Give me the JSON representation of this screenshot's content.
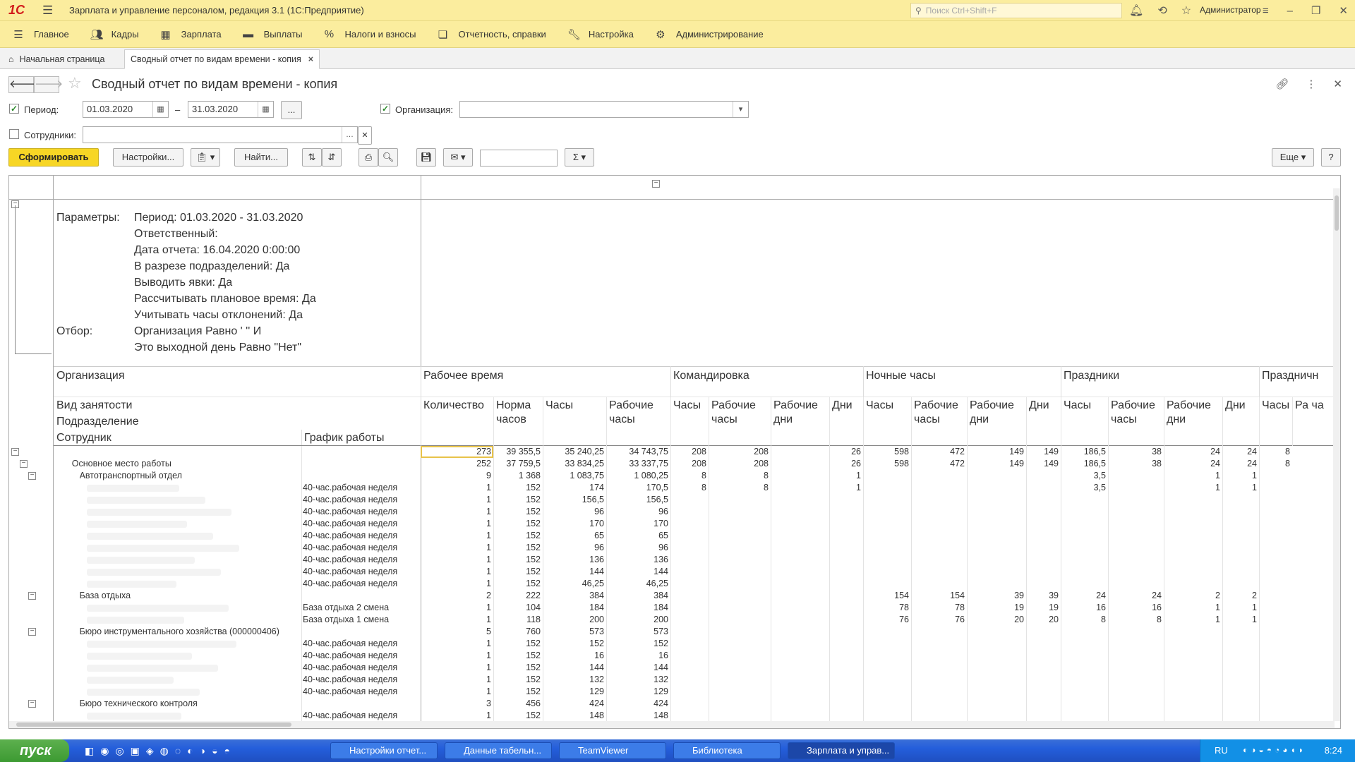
{
  "window": {
    "title": "Зарплата и управление персоналом, редакция 3.1  (1С:Предприятие)",
    "logo": "1С",
    "search_placeholder": "Поиск Ctrl+Shift+F",
    "user": "Администратор"
  },
  "menu": [
    "Главное",
    "Кадры",
    "Зарплата",
    "Выплаты",
    "Налоги и взносы",
    "Отчетность, справки",
    "Настройка",
    "Администрирование"
  ],
  "tabs": {
    "home": "Начальная страница",
    "active": "Сводный отчет по видам времени - копия",
    "close": "×"
  },
  "form": {
    "title": "Сводный отчет по видам времени - копия"
  },
  "filters": {
    "period_label": "Период:",
    "date_from": "01.03.2020",
    "dash": "–",
    "date_to": "31.03.2020",
    "ellipsis": "...",
    "org_label": "Организация:",
    "emp_label": "Сотрудники:"
  },
  "toolbar": {
    "generate": "Сформировать",
    "settings": "Настройки...",
    "find": "Найти...",
    "more": "Еще",
    "help": "?"
  },
  "params": {
    "label_params": "Параметры:",
    "label_filter": "Отбор:",
    "lines": [
      "Период: 01.03.2020 - 31.03.2020",
      "Ответственный:",
      "Дата отчета: 16.04.2020 0:00:00",
      "В разрезе подразделений: Да",
      "Выводить явки: Да",
      "Рассчитывать плановое время: Да",
      "Учитывать часы отклонений: Да"
    ],
    "filter_lines": [
      "Организация Равно '                   '' И",
      "Это выходной день Равно \"Нет\""
    ]
  },
  "headers": {
    "left": [
      "Организация",
      "Вид занятости",
      "Подразделение",
      "Сотрудник",
      "График работы"
    ],
    "groups": [
      "Рабочее время",
      "Командировка",
      "Ночные часы",
      "Праздники",
      "Праздничн"
    ],
    "sub": [
      "Количество",
      "Норма часов",
      "Часы",
      "Рабочие часы",
      "Часы",
      "Рабочие часы",
      "Рабочие дни",
      "Дни",
      "Часы",
      "Рабочие часы",
      "Рабочие дни",
      "Дни",
      "Часы",
      "Рабочие часы",
      "Рабочие дни",
      "Дни",
      "Часы",
      "Ра ча"
    ]
  },
  "rows": [
    {
      "name": "",
      "sched": "",
      "v": [
        "273",
        "39 355,5",
        "35 240,25",
        "34 743,75",
        "208",
        "208",
        "",
        "26",
        "598",
        "472",
        "149",
        "149",
        "186,5",
        "38",
        "24",
        "24",
        "8"
      ],
      "level": 0
    },
    {
      "name": "Основное место работы",
      "sched": "",
      "v": [
        "252",
        "37 759,5",
        "33 834,25",
        "33 337,75",
        "208",
        "208",
        "",
        "26",
        "598",
        "472",
        "149",
        "149",
        "186,5",
        "38",
        "24",
        "24",
        "8"
      ],
      "level": 1
    },
    {
      "name": "Автотранспортный отдел",
      "sched": "",
      "v": [
        "9",
        "1 368",
        "1 083,75",
        "1 080,25",
        "8",
        "8",
        "",
        "1",
        "",
        "",
        "",
        "",
        "3,5",
        "",
        "1",
        "1",
        ""
      ],
      "level": 2
    },
    {
      "name": "",
      "sched": "40-час.рабочая неделя",
      "v": [
        "1",
        "152",
        "174",
        "170,5",
        "8",
        "8",
        "",
        "1",
        "",
        "",
        "",
        "",
        "3,5",
        "",
        "1",
        "1",
        ""
      ],
      "level": 3
    },
    {
      "name": "",
      "sched": "40-час.рабочая неделя",
      "v": [
        "1",
        "152",
        "156,5",
        "156,5",
        "",
        "",
        "",
        "",
        "",
        "",
        "",
        "",
        "",
        "",
        "",
        "",
        ""
      ],
      "level": 3
    },
    {
      "name": "",
      "sched": "40-час.рабочая неделя",
      "v": [
        "1",
        "152",
        "96",
        "96",
        "",
        "",
        "",
        "",
        "",
        "",
        "",
        "",
        "",
        "",
        "",
        "",
        ""
      ],
      "level": 3
    },
    {
      "name": "",
      "sched": "40-час.рабочая неделя",
      "v": [
        "1",
        "152",
        "170",
        "170",
        "",
        "",
        "",
        "",
        "",
        "",
        "",
        "",
        "",
        "",
        "",
        "",
        ""
      ],
      "level": 3
    },
    {
      "name": "",
      "sched": "40-час.рабочая неделя",
      "v": [
        "1",
        "152",
        "65",
        "65",
        "",
        "",
        "",
        "",
        "",
        "",
        "",
        "",
        "",
        "",
        "",
        "",
        ""
      ],
      "level": 3
    },
    {
      "name": "",
      "sched": "40-час.рабочая неделя",
      "v": [
        "1",
        "152",
        "96",
        "96",
        "",
        "",
        "",
        "",
        "",
        "",
        "",
        "",
        "",
        "",
        "",
        "",
        ""
      ],
      "level": 3
    },
    {
      "name": "",
      "sched": "40-час.рабочая неделя",
      "v": [
        "1",
        "152",
        "136",
        "136",
        "",
        "",
        "",
        "",
        "",
        "",
        "",
        "",
        "",
        "",
        "",
        "",
        ""
      ],
      "level": 3
    },
    {
      "name": "",
      "sched": "40-час.рабочая неделя",
      "v": [
        "1",
        "152",
        "144",
        "144",
        "",
        "",
        "",
        "",
        "",
        "",
        "",
        "",
        "",
        "",
        "",
        "",
        ""
      ],
      "level": 3
    },
    {
      "name": "",
      "sched": "40-час.рабочая неделя",
      "v": [
        "1",
        "152",
        "46,25",
        "46,25",
        "",
        "",
        "",
        "",
        "",
        "",
        "",
        "",
        "",
        "",
        "",
        "",
        ""
      ],
      "level": 3
    },
    {
      "name": "База отдыха",
      "sched": "",
      "v": [
        "2",
        "222",
        "384",
        "384",
        "",
        "",
        "",
        "",
        "154",
        "154",
        "39",
        "39",
        "24",
        "24",
        "2",
        "2",
        ""
      ],
      "level": 2
    },
    {
      "name": "",
      "sched": "База отдыха 2 смена",
      "v": [
        "1",
        "104",
        "184",
        "184",
        "",
        "",
        "",
        "",
        "78",
        "78",
        "19",
        "19",
        "16",
        "16",
        "1",
        "1",
        ""
      ],
      "level": 3
    },
    {
      "name": "",
      "sched": "База отдыха 1 смена",
      "v": [
        "1",
        "118",
        "200",
        "200",
        "",
        "",
        "",
        "",
        "76",
        "76",
        "20",
        "20",
        "8",
        "8",
        "1",
        "1",
        ""
      ],
      "level": 3
    },
    {
      "name": "Бюро инструментального хозяйства (000000406)",
      "sched": "",
      "v": [
        "5",
        "760",
        "573",
        "573",
        "",
        "",
        "",
        "",
        "",
        "",
        "",
        "",
        "",
        "",
        "",
        "",
        ""
      ],
      "level": 2
    },
    {
      "name": "",
      "sched": "40-час.рабочая неделя",
      "v": [
        "1",
        "152",
        "152",
        "152",
        "",
        "",
        "",
        "",
        "",
        "",
        "",
        "",
        "",
        "",
        "",
        "",
        ""
      ],
      "level": 3
    },
    {
      "name": "",
      "sched": "40-час.рабочая неделя",
      "v": [
        "1",
        "152",
        "16",
        "16",
        "",
        "",
        "",
        "",
        "",
        "",
        "",
        "",
        "",
        "",
        "",
        "",
        ""
      ],
      "level": 3
    },
    {
      "name": "",
      "sched": "40-час.рабочая неделя",
      "v": [
        "1",
        "152",
        "144",
        "144",
        "",
        "",
        "",
        "",
        "",
        "",
        "",
        "",
        "",
        "",
        "",
        "",
        ""
      ],
      "level": 3
    },
    {
      "name": "",
      "sched": "40-час.рабочая неделя",
      "v": [
        "1",
        "152",
        "132",
        "132",
        "",
        "",
        "",
        "",
        "",
        "",
        "",
        "",
        "",
        "",
        "",
        "",
        ""
      ],
      "level": 3
    },
    {
      "name": "",
      "sched": "40-час.рабочая неделя",
      "v": [
        "1",
        "152",
        "129",
        "129",
        "",
        "",
        "",
        "",
        "",
        "",
        "",
        "",
        "",
        "",
        "",
        "",
        ""
      ],
      "level": 3
    },
    {
      "name": "Бюро технического контроля",
      "sched": "",
      "v": [
        "3",
        "456",
        "424",
        "424",
        "",
        "",
        "",
        "",
        "",
        "",
        "",
        "",
        "",
        "",
        "",
        "",
        ""
      ],
      "level": 2
    },
    {
      "name": "",
      "sched": "40-час.рабочая неделя",
      "v": [
        "1",
        "152",
        "148",
        "148",
        "",
        "",
        "",
        "",
        "",
        "",
        "",
        "",
        "",
        "",
        "",
        "",
        ""
      ],
      "level": 3
    }
  ],
  "taskbar": {
    "start": "пуск",
    "tasks": [
      "Настройки отчет...",
      "Данные табельн...",
      "TeamViewer",
      "Библиотека",
      "Зарплата и управ..."
    ],
    "lang": "RU",
    "time": "8:24"
  }
}
